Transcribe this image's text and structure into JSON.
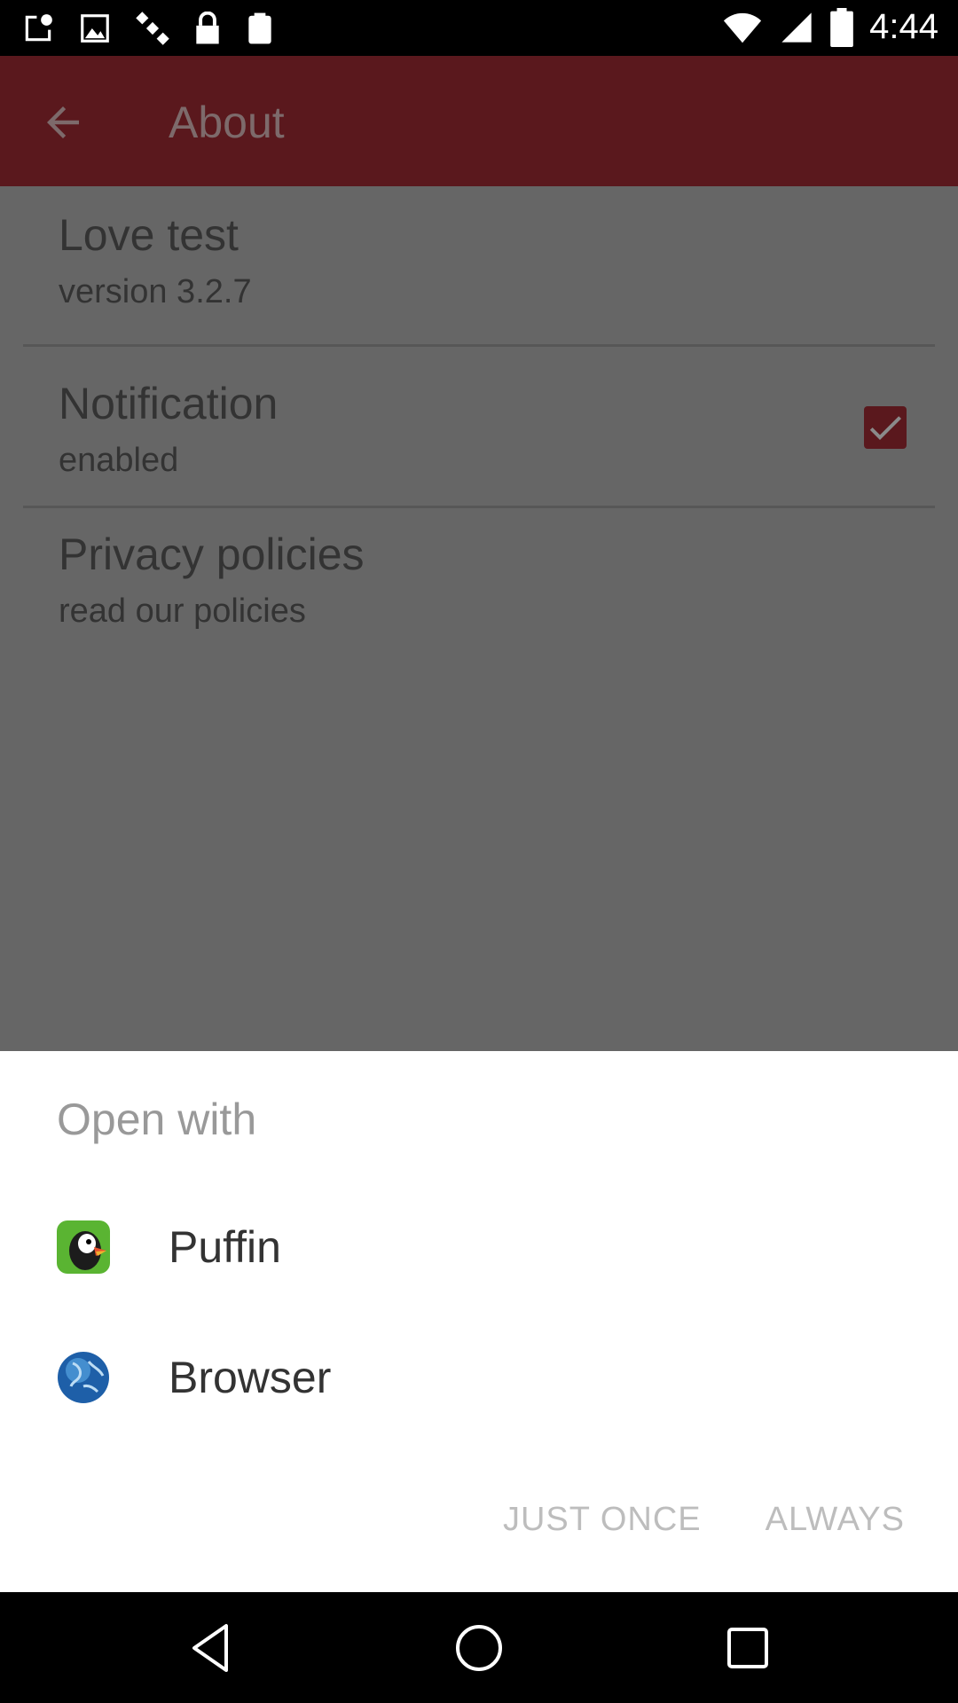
{
  "status_bar": {
    "time": "4:44",
    "icons": [
      "notification-icon",
      "image-icon",
      "satellite-icon",
      "lock-icon",
      "clipboard-icon",
      "wifi-icon",
      "signal-icon",
      "battery-icon"
    ]
  },
  "app_bar": {
    "title": "About",
    "back_icon": "arrow-back-icon",
    "color": "#5a181d"
  },
  "preferences": [
    {
      "title": "Love test",
      "summary": "version 3.2.7"
    },
    {
      "title": "Notification",
      "summary": "enabled",
      "checked": true
    },
    {
      "title": "Privacy policies",
      "summary": "read our policies"
    }
  ],
  "chooser": {
    "title": "Open with",
    "apps": [
      {
        "label": "Puffin",
        "icon": "puffin-icon"
      },
      {
        "label": "Browser",
        "icon": "globe-icon"
      }
    ],
    "actions": {
      "just_once": "JUST ONCE",
      "always": "ALWAYS"
    }
  },
  "nav_bar": {
    "icons": [
      "back-triangle-icon",
      "home-circle-icon",
      "recents-square-icon"
    ]
  }
}
